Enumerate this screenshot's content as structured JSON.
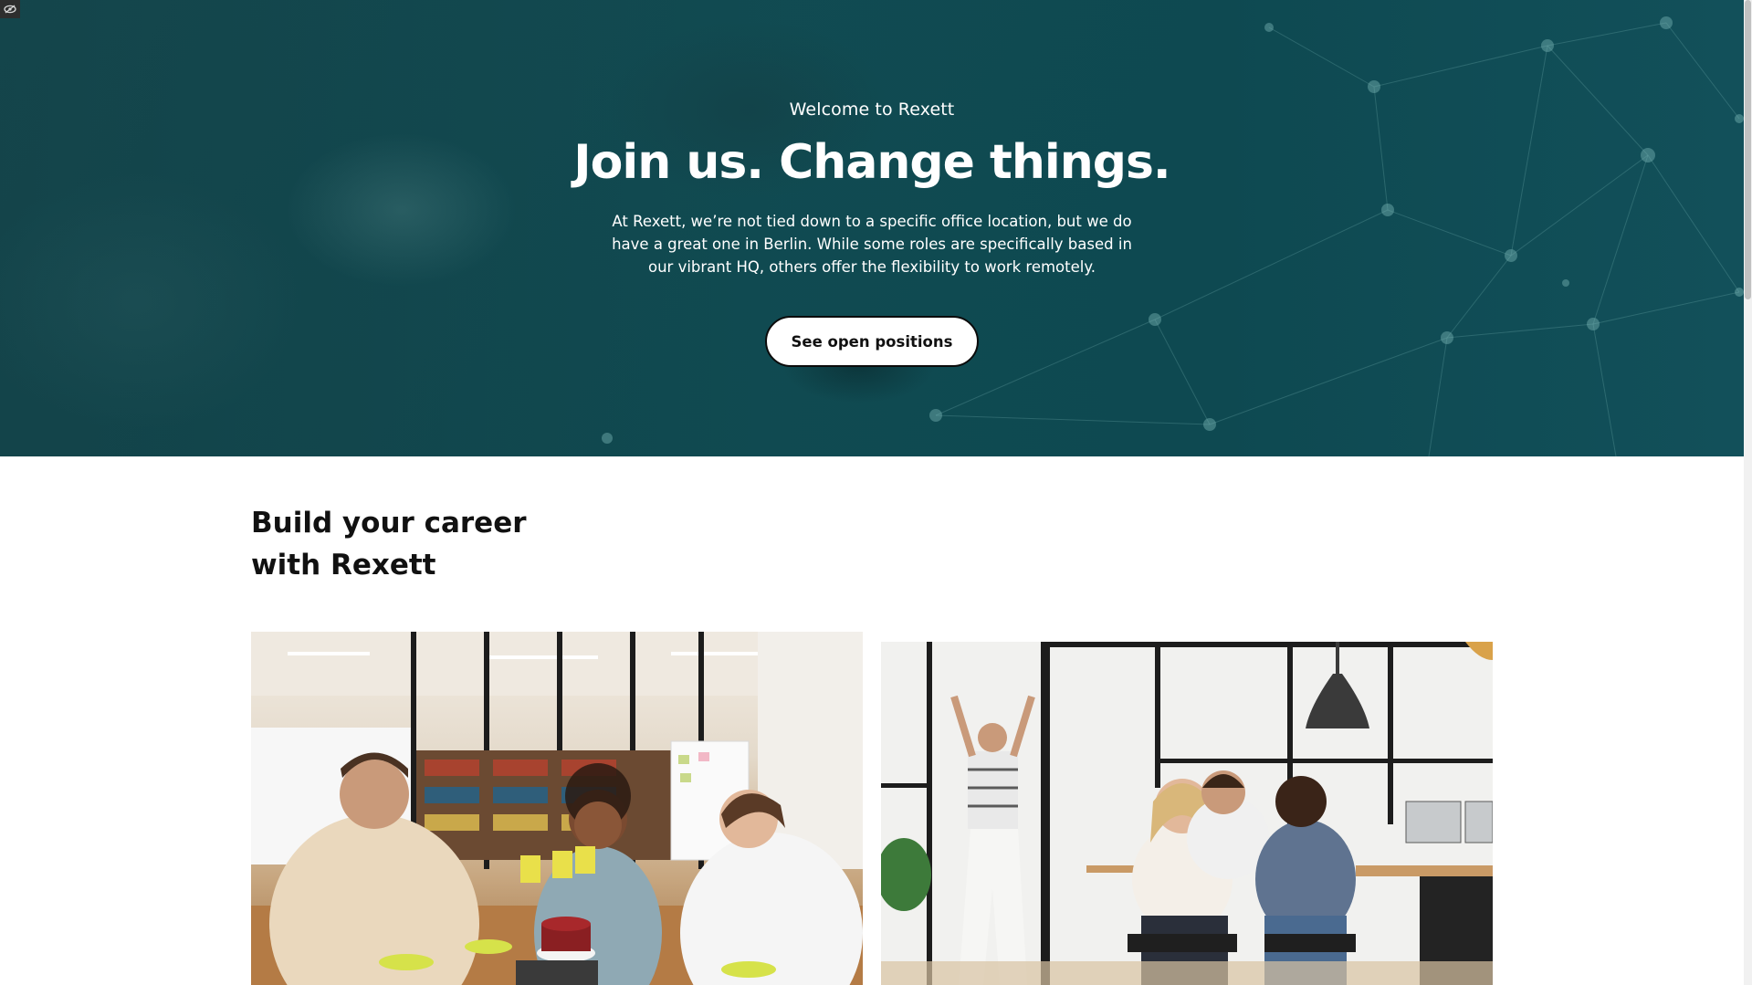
{
  "hero": {
    "eyebrow": "Welcome to Rexett",
    "title": "Join us. Change things.",
    "description": "At Rexett, we’re not tied down to a specific office location, but we do have a great one in Berlin. While some roles are specifically based in our vibrant HQ, others offer the flexibility to work remotely.",
    "cta_label": "See open positions",
    "background_color": "#0f4a51"
  },
  "career": {
    "heading_line1": "Build your career",
    "heading_line2": "with Rexett"
  },
  "icons": {
    "corner": "eye-slash-icon"
  },
  "colors": {
    "hero_overlay": "#0f4a51",
    "button_bg": "#ffffff",
    "button_border": "#0b0b0b",
    "heading_text": "#111111"
  }
}
